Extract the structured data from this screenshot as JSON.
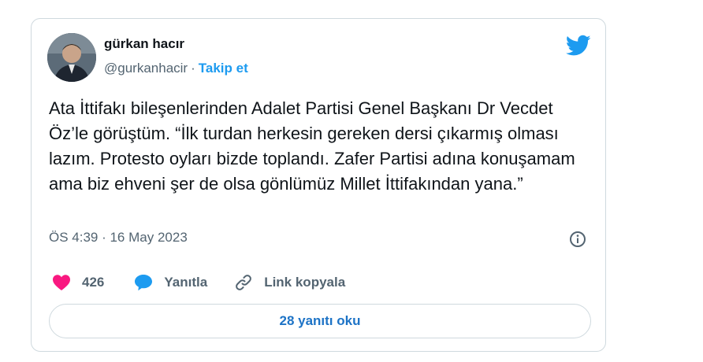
{
  "tweet": {
    "author_name": "gürkan hacır",
    "author_handle": "@gurkanhacir",
    "separator": "·",
    "follow_label": "Takip et",
    "text": "Ata İttifakı bileşenlerinden Adalet Partisi Genel Başkanı Dr Vecdet Öz’le görüştüm. “İlk turdan herkesin gereken dersi çıkarmış olması lazım. Protesto oyları bizde toplandı. Zafer Partisi adına konuşamam ama biz ehveni şer de olsa gönlümüz Millet İttifakından yana.”",
    "timestamp": "ÖS 4:39 · 16 May 2023"
  },
  "actions": {
    "like_count": "426",
    "reply_label": "Yanıtla",
    "copy_label": "Link kopyala"
  },
  "read_replies_label": "28 yanıtı oku",
  "icons": {
    "brand": "twitter-bird-icon",
    "info": "info-icon",
    "like": "heart-icon",
    "reply": "speech-bubble-icon",
    "copy": "link-icon"
  },
  "colors": {
    "accent": "#1d9bf0",
    "like": "#f91880",
    "muted": "#536471",
    "text": "#0f1419",
    "border": "#cfd9de"
  }
}
